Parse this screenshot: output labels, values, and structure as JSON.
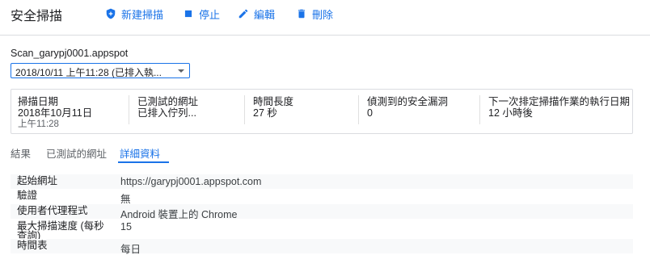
{
  "header": {
    "title": "安全掃描",
    "new_scan_label": "新建掃描",
    "stop_label": "停止",
    "edit_label": "編輯",
    "delete_label": "刪除"
  },
  "scan": {
    "name": "Scan_garypj0001.appspot",
    "run_selector": "2018/10/11 上午11:28 (已排入執..."
  },
  "summary": {
    "scan_date_label": "掃描日期",
    "scan_date": "2018年10月11日",
    "scan_time": "上午11:28",
    "tested_urls_label": "已測試的網址",
    "tested_urls_value": "已排入佇列...",
    "duration_label": "時間長度",
    "duration_value": "27 秒",
    "vulns_label": "偵測到的安全漏洞",
    "vulns_value": "0",
    "next_run_label": "下一次排定掃描作業的執行日期",
    "next_run_value": "12 小時後"
  },
  "tabs": [
    "結果",
    "已測試的網址",
    "詳細資料"
  ],
  "active_tab": 2,
  "details": [
    {
      "key": "起始網址",
      "value": "https://garypj0001.appspot.com"
    },
    {
      "key": "驗證",
      "value": "無"
    },
    {
      "key": "使用者代理程式",
      "value": "Android 裝置上的 Chrome"
    },
    {
      "key": "最大掃描速度 (每秒查詢)",
      "value": "15"
    },
    {
      "key": "時間表",
      "value": "每日"
    }
  ],
  "colors": {
    "accent": "#1a73e8"
  }
}
